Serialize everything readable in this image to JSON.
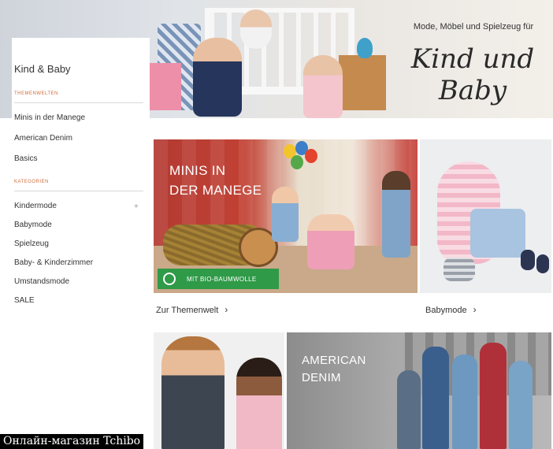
{
  "hero": {
    "subtitle": "Mode, Möbel und Spielzeug für",
    "title": "Kind und Baby"
  },
  "sidebar": {
    "brand": "Kind & Baby",
    "section_themes": "THEMENWELTEN",
    "themes": [
      "Minis in der Manege",
      "American Denim",
      "Basics"
    ],
    "section_categories": "KATEGORIEN",
    "categories": [
      "Kindermode",
      "Babymode",
      "Spielzeug",
      "Baby- & Kinderzimmer",
      "Umstandsmode",
      "SALE"
    ],
    "expand_symbol": "+"
  },
  "tiles": {
    "manege": {
      "title": "MINIS IN\nDER MANEGE",
      "badge": "MIT BIO-BAUMWOLLE",
      "link": "Zur Themenwelt",
      "arrow": "›"
    },
    "babymode": {
      "link": "Babymode",
      "arrow": "›"
    },
    "denim": {
      "title": "AMERICAN\nDENIM"
    }
  },
  "caption": "Онлайн-магазин Tchibo",
  "colors": {
    "accent": "#d26b3a",
    "badge": "#2f9a48",
    "circus_red": "#c24134"
  },
  "icons": [
    "leaf-icon",
    "chevron-right-icon",
    "plus-icon"
  ]
}
